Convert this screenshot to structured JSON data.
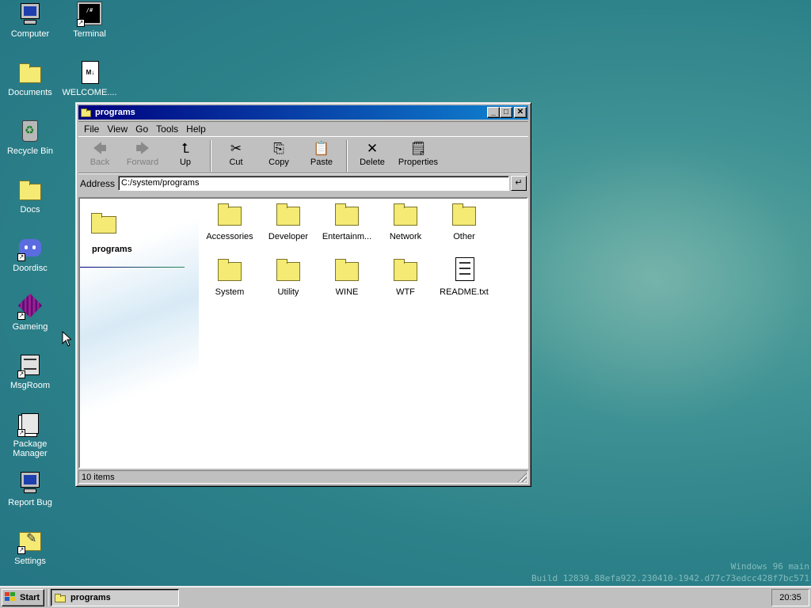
{
  "desktop": {
    "icons": [
      {
        "label": "Computer",
        "icon": "computer-icon"
      },
      {
        "label": "Terminal",
        "icon": "terminal-icon"
      },
      {
        "label": "Documents",
        "icon": "documents-folder-icon"
      },
      {
        "label": "WELCOME....",
        "icon": "markdown-file-icon",
        "badge": "M↓"
      },
      {
        "label": "Recycle Bin",
        "icon": "recycle-bin-icon"
      },
      {
        "label": "Docs",
        "icon": "folder-icon"
      },
      {
        "label": "Doordisc",
        "icon": "discord-icon"
      },
      {
        "label": "Gameing",
        "icon": "game-cube-icon"
      },
      {
        "label": "MsgRoom",
        "icon": "msgroom-icon"
      },
      {
        "label": "Package Manager",
        "icon": "package-manager-icon"
      },
      {
        "label": "Report Bug",
        "icon": "report-bug-icon"
      },
      {
        "label": "Settings",
        "icon": "settings-icon"
      }
    ],
    "watermark_line1": "Windows 96 main",
    "watermark_line2": "Build 12839.88efa922.230410-1942.d77c73edcc428f7bc571"
  },
  "window": {
    "title": "programs",
    "controls": {
      "minimize": "_",
      "maximize": "□",
      "close": "✕"
    },
    "menu": [
      "File",
      "View",
      "Go",
      "Tools",
      "Help"
    ],
    "toolbar": [
      {
        "label": "Back",
        "glyph": "🡄",
        "disabled": true
      },
      {
        "label": "Forward",
        "glyph": "🡆",
        "disabled": true
      },
      {
        "label": "Up",
        "glyph": "⮤",
        "disabled": false
      },
      {
        "label": "Cut",
        "glyph": "✂",
        "disabled": false
      },
      {
        "label": "Copy",
        "glyph": "⎘",
        "disabled": false
      },
      {
        "label": "Paste",
        "glyph": "📋",
        "disabled": false
      },
      {
        "label": "Delete",
        "glyph": "✕",
        "disabled": false
      },
      {
        "label": "Properties",
        "glyph": "🗒",
        "disabled": false
      }
    ],
    "address_label": "Address",
    "address_value": "C:/system/programs",
    "address_go": "↵",
    "sidepane_title": "programs",
    "files": [
      {
        "name": "Accessories",
        "type": "folder"
      },
      {
        "name": "Developer",
        "type": "folder"
      },
      {
        "name": "Entertainm...",
        "type": "folder"
      },
      {
        "name": "Network",
        "type": "folder"
      },
      {
        "name": "Other",
        "type": "folder"
      },
      {
        "name": "System",
        "type": "folder"
      },
      {
        "name": "Utility",
        "type": "folder"
      },
      {
        "name": "WINE",
        "type": "folder"
      },
      {
        "name": "WTF",
        "type": "folder"
      },
      {
        "name": "README.txt",
        "type": "text-file"
      }
    ],
    "status": "10 items"
  },
  "taskbar": {
    "start_label": "Start",
    "items": [
      {
        "label": "programs"
      }
    ],
    "clock": "20:35"
  },
  "colors": {
    "title_gradient_start": "#000080",
    "title_gradient_end": "#1084d0",
    "desktop": "#2c8189",
    "folder": "#f4ea74"
  }
}
